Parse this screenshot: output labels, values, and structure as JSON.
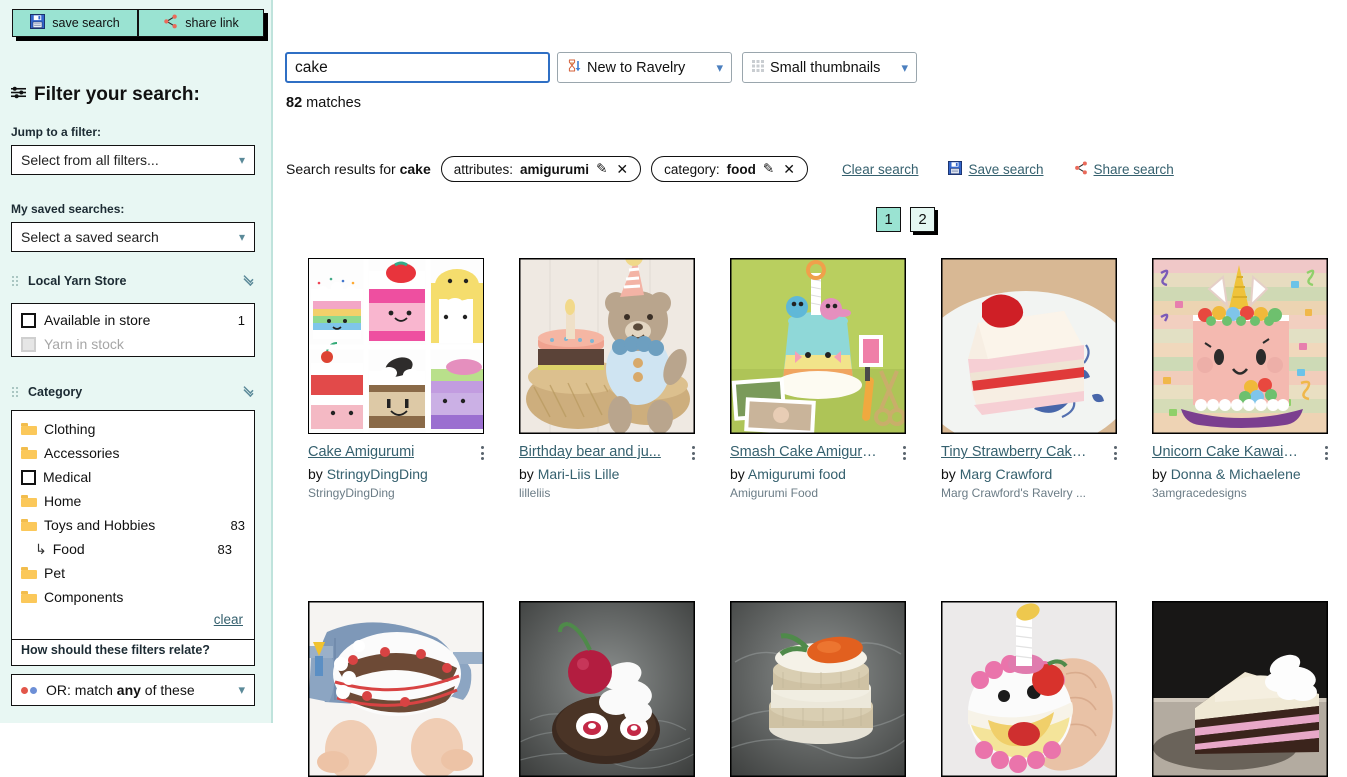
{
  "sidebar": {
    "buttons": [
      {
        "label": "save search",
        "icon": "floppy-disk-icon"
      },
      {
        "label": "share link",
        "icon": "share-nodes-icon"
      }
    ],
    "title": "Filter your search:",
    "title_icon": "sliders-icon",
    "jump_label": "Jump to a filter:",
    "jump_value": "Select from all filters...",
    "saved_label": "My saved searches:",
    "saved_value": "Select a saved search",
    "groups": [
      {
        "name": "Local Yarn Store",
        "rows": [
          {
            "label": "Available in store",
            "count": "1",
            "disabled": false
          },
          {
            "label": "Yarn in stock",
            "count": "",
            "disabled": true
          }
        ]
      },
      {
        "name": "Category",
        "rows": [
          {
            "label": "Clothing",
            "count": "",
            "kind": "folder"
          },
          {
            "label": "Accessories",
            "count": "",
            "kind": "folder"
          },
          {
            "label": "Medical",
            "count": "",
            "kind": "checkbox"
          },
          {
            "label": "Home",
            "count": "",
            "kind": "folder"
          },
          {
            "label": "Toys and Hobbies",
            "count": "83",
            "kind": "folder"
          },
          {
            "label": "Food",
            "count": "83",
            "kind": "sub"
          },
          {
            "label": "Pet",
            "count": "",
            "kind": "folder"
          },
          {
            "label": "Components",
            "count": "",
            "kind": "folder"
          }
        ],
        "clear_label": "clear",
        "relate_label": "How should these filters relate?",
        "relate_value_pre": "OR: match ",
        "relate_value_bold": "any",
        "relate_value_post": " of these"
      }
    ]
  },
  "search": {
    "value": "cake",
    "sort": {
      "label": "New to Ravelry",
      "icon": "sort-hourglass-icon"
    },
    "view": {
      "label": "Small thumbnails",
      "icon": "grid-icon"
    },
    "matches_count": "82",
    "matches_word": "matches"
  },
  "results_bar": {
    "prefix": "Search results for ",
    "query": "cake",
    "chips": [
      {
        "key": "attributes:",
        "value": "amigurumi",
        "edit_icon": "pencil-icon",
        "close_icon": "close-icon"
      },
      {
        "key": "category:",
        "value": "food",
        "edit_icon": "pencil-icon",
        "close_icon": "close-icon"
      }
    ],
    "clear_search": "Clear search",
    "save_search": "Save search",
    "share_search": "Share search",
    "save_icon": "floppy-disk-icon",
    "share_icon": "share-nodes-icon"
  },
  "pagination": {
    "pages": [
      {
        "label": "1",
        "current": true
      },
      {
        "label": "2",
        "current": false
      }
    ]
  },
  "results": [
    {
      "title": "Cake Amigurumi",
      "by_prefix": "by ",
      "designer": "StringyDingDing",
      "shop": "StringyDingDing",
      "thumb": "collage-six-kawaii-cakes"
    },
    {
      "title": "Birthday bear and ju...",
      "by_prefix": "by ",
      "designer": "Mari-Liis Lille",
      "shop": "lilleliis",
      "thumb": "teddy-bear-with-cake"
    },
    {
      "title": "Smash Cake Amiguru...",
      "by_prefix": "by ",
      "designer": "Amigurumi food",
      "shop": "Amigurumi Food",
      "thumb": "pastel-smash-cake-green-bg"
    },
    {
      "title": "Tiny Strawberry Cake...",
      "by_prefix": "by ",
      "designer": "Marg Crawford",
      "shop": "Marg Crawford's Ravelry ...",
      "thumb": "knitted-cake-slice-on-plate"
    },
    {
      "title": "Unicorn Cake Kawaii ...",
      "by_prefix": "by ",
      "designer": "Donna & Michaelene",
      "shop": "3amgracedesigns",
      "thumb": "unicorn-cake-pink"
    },
    {
      "title": "",
      "by_prefix": "",
      "designer": "",
      "shop": "",
      "thumb": "baby-cake-pants"
    },
    {
      "title": "",
      "by_prefix": "",
      "designer": "",
      "shop": "",
      "thumb": "cherry-roll-cake-dark"
    },
    {
      "title": "",
      "by_prefix": "",
      "designer": "",
      "shop": "",
      "thumb": "carrot-mini-cake-dark"
    },
    {
      "title": "",
      "by_prefix": "",
      "designer": "",
      "shop": "",
      "thumb": "smiling-cake-in-hand"
    },
    {
      "title": "",
      "by_prefix": "",
      "designer": "",
      "shop": "",
      "thumb": "chocolate-cake-slice-dark"
    }
  ],
  "colors": {
    "sidebar_bg": "#e8f7f3",
    "button_teal": "#9ae3d2",
    "link_blue": "#35606e",
    "focus_blue": "#2f6fc4",
    "folder_yellow": "#fbc85a"
  }
}
